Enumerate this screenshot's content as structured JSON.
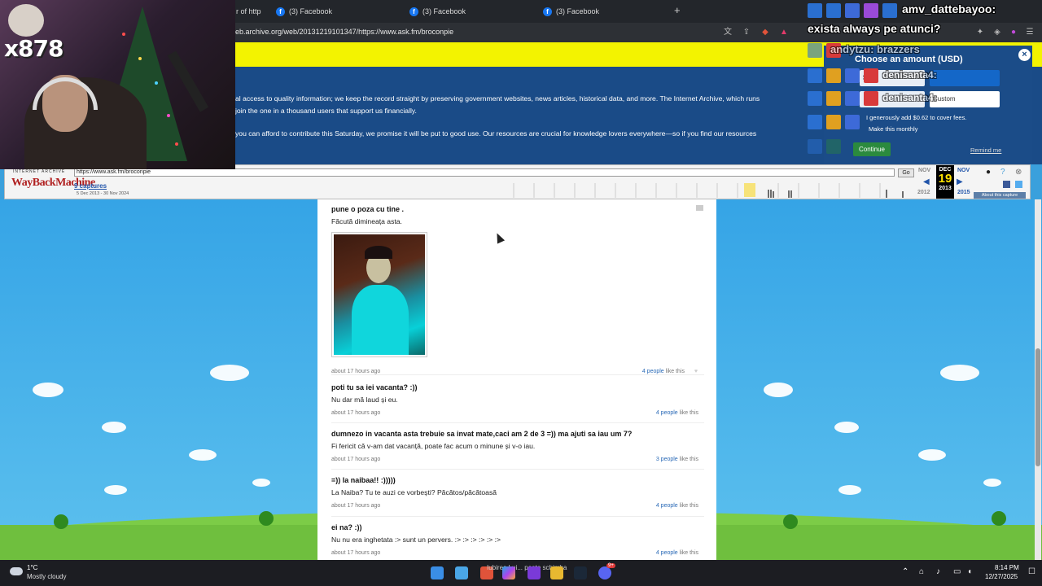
{
  "browser": {
    "tabs": [
      {
        "label": "r of http"
      },
      {
        "label": "(3) Facebook"
      },
      {
        "label": "(3) Facebook"
      },
      {
        "label": "(3) Facebook"
      }
    ],
    "new_tab": "+",
    "url": "eb.archive.org/web/20131219101347/https://www.ask.fm/broconpie"
  },
  "banner": {
    "line1": "al access to quality information; we keep the record straight by preserving government websites, news articles, historical data, and more. The Internet Archive, which runs",
    "line2": "join the one in a thousand users that support us financially.",
    "line3": "you can afford to contribute this Saturday, we promise it will be put to good use. Our resources are crucial for knowledge lovers everywhere—so if you find our resources",
    "donate_title": "Choose an amount (USD)",
    "amount_1": "$0",
    "amount_2": "Custom",
    "generous_line": "I generously add $0.62 to cover fees.",
    "make_monthly": "Make this monthly",
    "continue": "Continue",
    "remind": "Remind me",
    "close": "×"
  },
  "wayback": {
    "logo_top": "INTERNET ARCHIVE",
    "logo": "WayBackMachine",
    "url_value": "https://www.ask.fm/broconpie",
    "go": "Go",
    "captures": "9 captures",
    "range": "5 Dec 2013 - 30 Nov 2024",
    "prev_month": "NOV",
    "cur_month": "DEC",
    "cur_day": "19",
    "cur_year": "2013",
    "next_month": "NOV",
    "prev_year": "2012",
    "next_year": "2015",
    "about": "About this capture"
  },
  "feed": {
    "items": [
      {
        "question": "pune o poza cu tine .",
        "answer": "Făcută dimineața asta.",
        "time": "about 17 hours ago",
        "likes_count": "4 people",
        "likes_suffix": "like this"
      },
      {
        "question": "poti tu sa iei vacanta? :))",
        "answer": "Nu dar mă laud și eu.",
        "time": "about 17 hours ago",
        "likes_count": "4 people",
        "likes_suffix": "like this"
      },
      {
        "question": "dumnezo in vacanta asta trebuie sa invat mate,caci am 2 de 3 =)) ma ajuti sa iau um 7?",
        "answer": "Fi fericit că v-am dat vacanță, poate fac acum o minune și v-o iau.",
        "time": "about 17 hours ago",
        "likes_count": "3 people",
        "likes_suffix": "like this"
      },
      {
        "question": "=)) la naibaa!! :)))))",
        "answer": "La Naiba? Tu te auzi ce vorbești? Păcătos/păcătoasă",
        "time": "about 17 hours ago",
        "likes_count": "4 people",
        "likes_suffix": "like this"
      },
      {
        "question": "ei na? :))",
        "answer": "Nu nu era inghetata :> sunt un pervers. :> :> :> :> :> :>",
        "time": "about 17 hours ago",
        "likes_count": "4 people",
        "likes_suffix": "like this"
      }
    ]
  },
  "stream": {
    "cam_name": "x878",
    "chat": [
      {
        "text": "amv_dattebayoo:"
      },
      {
        "text": "exista always pe atunci?"
      },
      {
        "text": "andytzu: brazzers"
      },
      {
        "text": "denisanta4:"
      },
      {
        "text": "denisanta4:"
      }
    ]
  },
  "taskbar": {
    "temp": "1°C",
    "weather": "Mostly cloudy",
    "now_playing": "Iubirea Lui... poate schimba",
    "time": "8:14 PM",
    "date": "12/27/2025",
    "discord_badge": "9+"
  },
  "colors": {
    "banner_blue": "#1a4b87",
    "banner_yellow": "#f3f300",
    "sky": "#3aa0dc",
    "grass": "#7ccc47",
    "link": "#2a6ab7"
  }
}
